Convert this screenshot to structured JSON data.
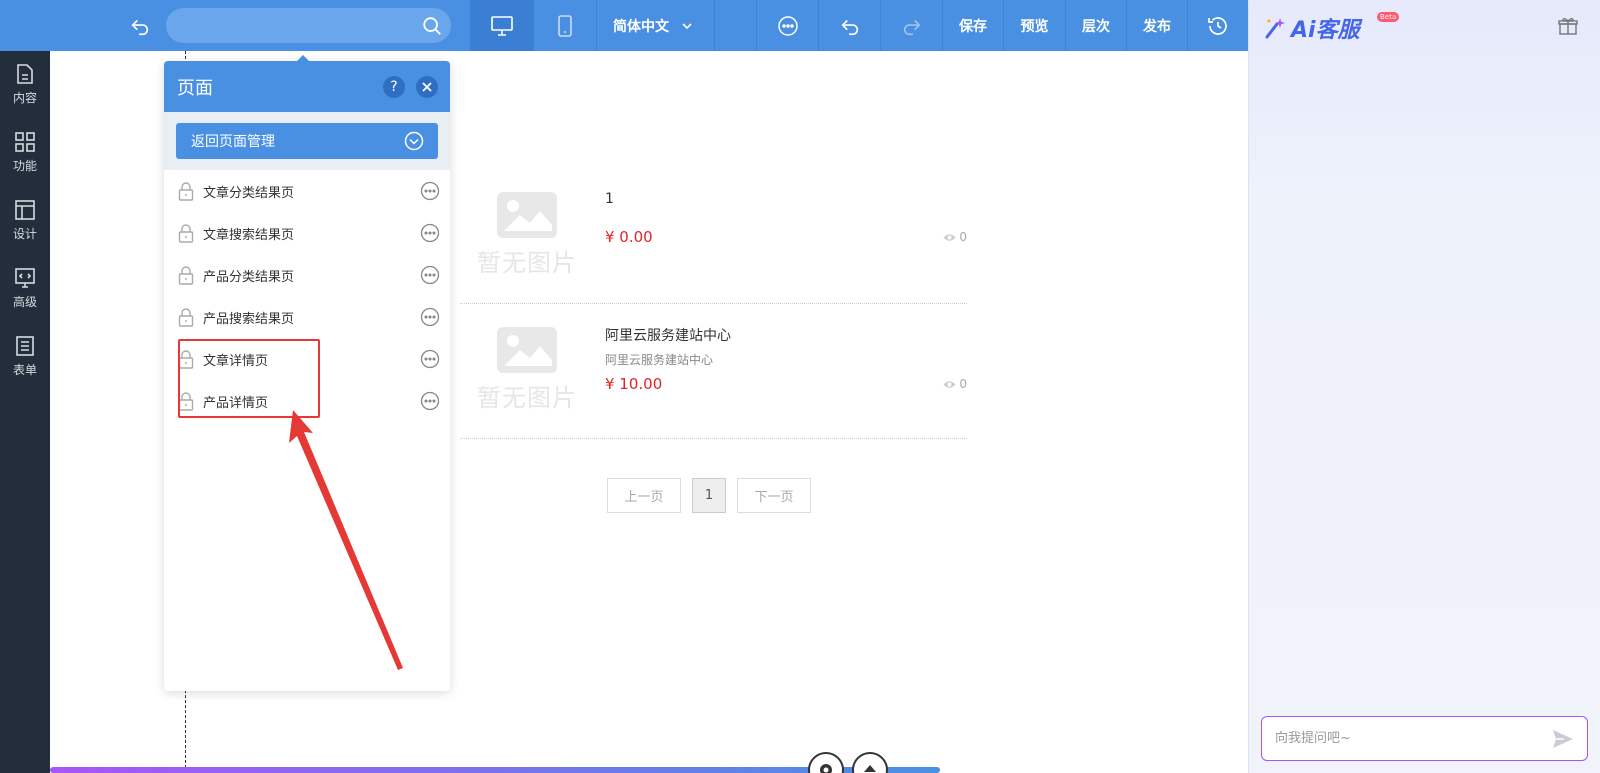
{
  "toolbar": {
    "search_placeholder": "",
    "language": "简体中文",
    "save": "保存",
    "preview": "预览",
    "level": "层次",
    "publish": "发布"
  },
  "sidebar": {
    "items": [
      {
        "label": "内容",
        "icon": "document-icon"
      },
      {
        "label": "功能",
        "icon": "grid-icon"
      },
      {
        "label": "设计",
        "icon": "layout-icon"
      },
      {
        "label": "高级",
        "icon": "code-monitor-icon"
      },
      {
        "label": "表单",
        "icon": "form-list-icon"
      }
    ]
  },
  "products": [
    {
      "title": "1",
      "subtitle": "",
      "price": "¥ 0.00",
      "views": "0",
      "noimg": "暂无图片"
    },
    {
      "title": "阿里云服务建站中心",
      "subtitle": "阿里云服务建站中心",
      "price": "¥ 10.00",
      "views": "0",
      "noimg": "暂无图片"
    }
  ],
  "pagination": {
    "prev": "上一页",
    "current": "1",
    "next": "下一页"
  },
  "panel": {
    "title": "页面",
    "help": "?",
    "back_label": "返回页面管理",
    "items": [
      {
        "label": "文章分类结果页"
      },
      {
        "label": "文章搜索结果页"
      },
      {
        "label": "产品分类结果页"
      },
      {
        "label": "产品搜索结果页"
      },
      {
        "label": "文章详情页"
      },
      {
        "label": "产品详情页"
      }
    ]
  },
  "ai": {
    "logo_text": "Ai客服",
    "beta": "Beta",
    "input_placeholder": "向我提问吧~"
  },
  "colors": {
    "toolbar": "#4a90e2",
    "sidebar": "#232d3b",
    "price": "#e02424",
    "highlight": "#e53935"
  }
}
